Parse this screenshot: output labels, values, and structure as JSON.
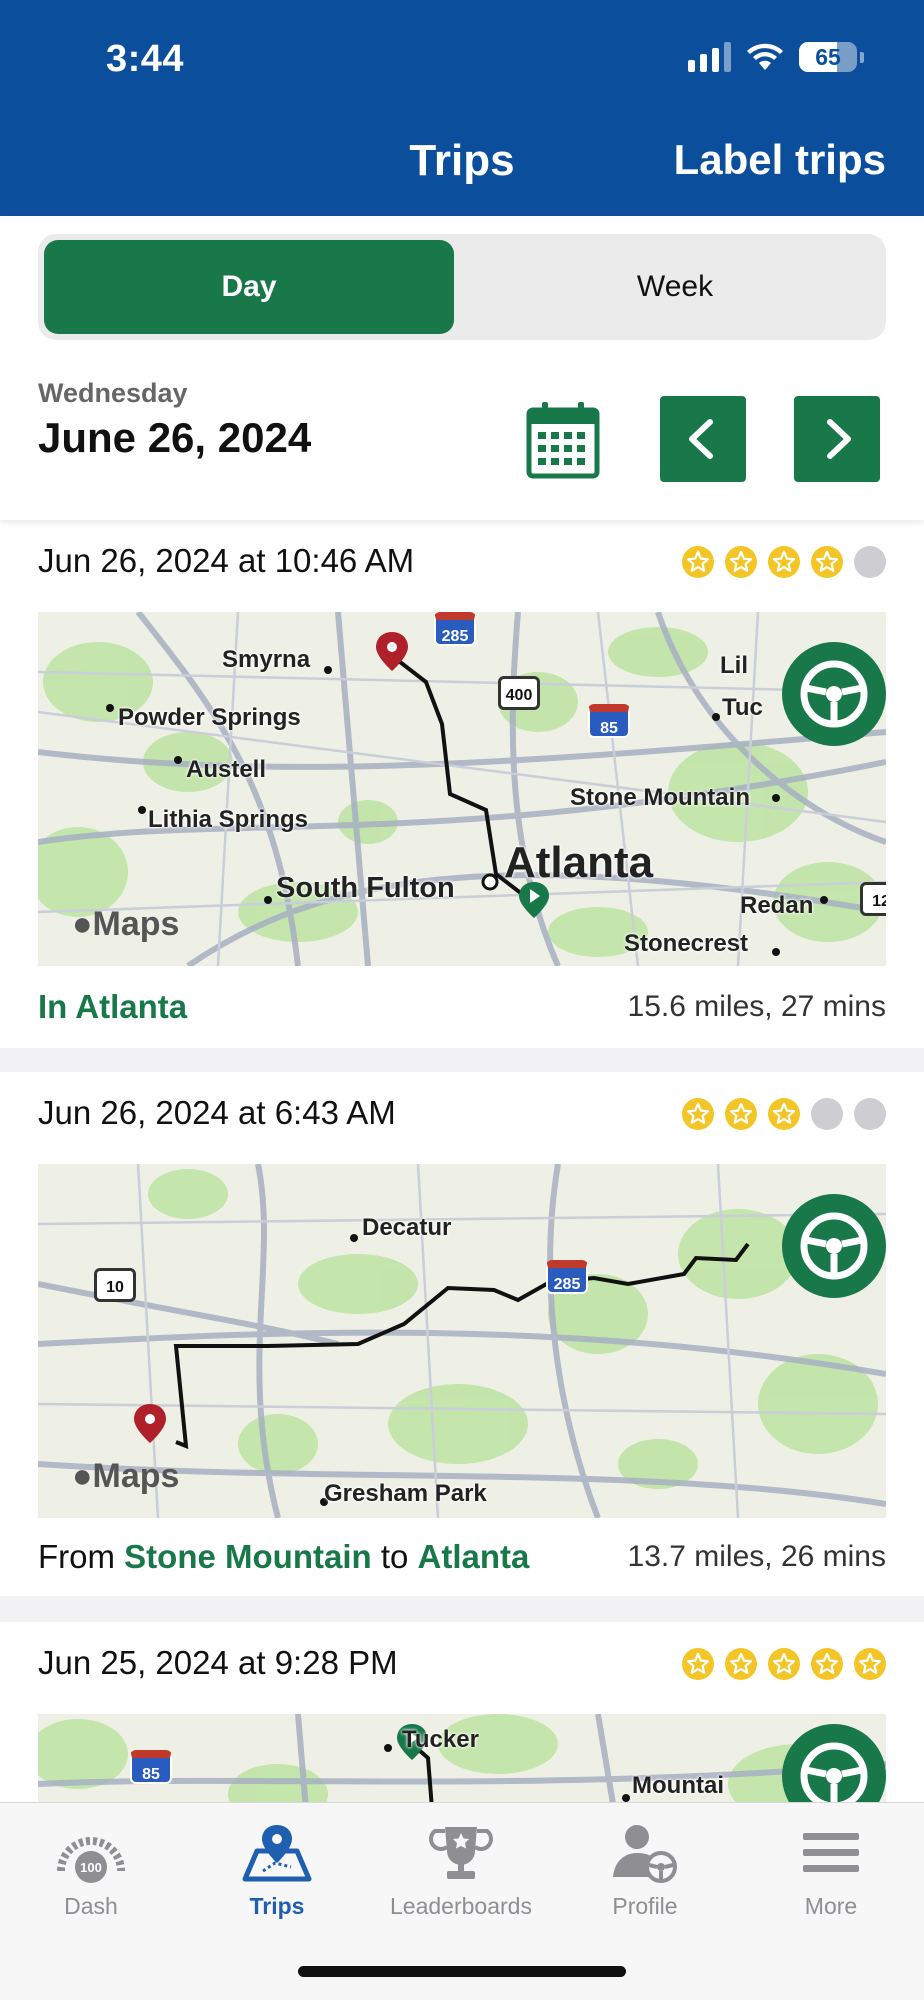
{
  "status_bar": {
    "time": "3:44",
    "battery": "65",
    "battery_level": 0.65
  },
  "header": {
    "title": "Trips",
    "action": "Label trips"
  },
  "segmented": {
    "options": [
      "Day",
      "Week"
    ],
    "selected": "Day"
  },
  "date": {
    "weekday": "Wednesday",
    "full": "June 26, 2024"
  },
  "trips": [
    {
      "datetime": "Jun 26, 2024 at 10:46 AM",
      "rating": 4,
      "location": {
        "prefix": "",
        "place": "In Atlanta"
      },
      "distance": "15.6 miles, 27 mins",
      "map_labels": {
        "smyrna": "Smyrna",
        "powder_springs": "Powder Springs",
        "austell": "Austell",
        "lithia_springs": "Lithia Springs",
        "south_fulton": "South Fulton",
        "atlanta": "Atlanta",
        "stone_mountain": "Stone Mountain",
        "redan": "Redan",
        "stonecrest": "Stonecrest",
        "lil": "Lil",
        "tuc": "Tuc",
        "us400": "400",
        "i285": "285",
        "i85": "85",
        "edge12": "12"
      }
    },
    {
      "datetime": "Jun 26, 2024 at 6:43 AM",
      "rating": 3,
      "location": {
        "from_word": "From",
        "from": "Stone Mountain",
        "to_word": "to",
        "to": "Atlanta"
      },
      "distance": "13.7 miles, 26 mins",
      "map_labels": {
        "decatur": "Decatur",
        "gresham_park": "Gresham Park",
        "us10": "10",
        "i285": "285"
      }
    },
    {
      "datetime": "Jun 25, 2024 at 9:28 PM",
      "rating": 5,
      "map_labels": {
        "tucker": "Tucker",
        "mountain": "Mountai",
        "i85": "85"
      }
    }
  ],
  "maps_brand": "Maps",
  "tabs": [
    {
      "label": "Dash",
      "icon": "dash-gauge-icon"
    },
    {
      "label": "Trips",
      "icon": "trips-map-icon",
      "active": true
    },
    {
      "label": "Leaderboards",
      "icon": "trophy-icon"
    },
    {
      "label": "Profile",
      "icon": "profile-wheel-icon"
    },
    {
      "label": "More",
      "icon": "menu-icon"
    }
  ],
  "colors": {
    "header": "#0b4f9c",
    "accent_green": "#19784a",
    "star": "#f3c526",
    "active_tab": "#1f5fb0"
  }
}
